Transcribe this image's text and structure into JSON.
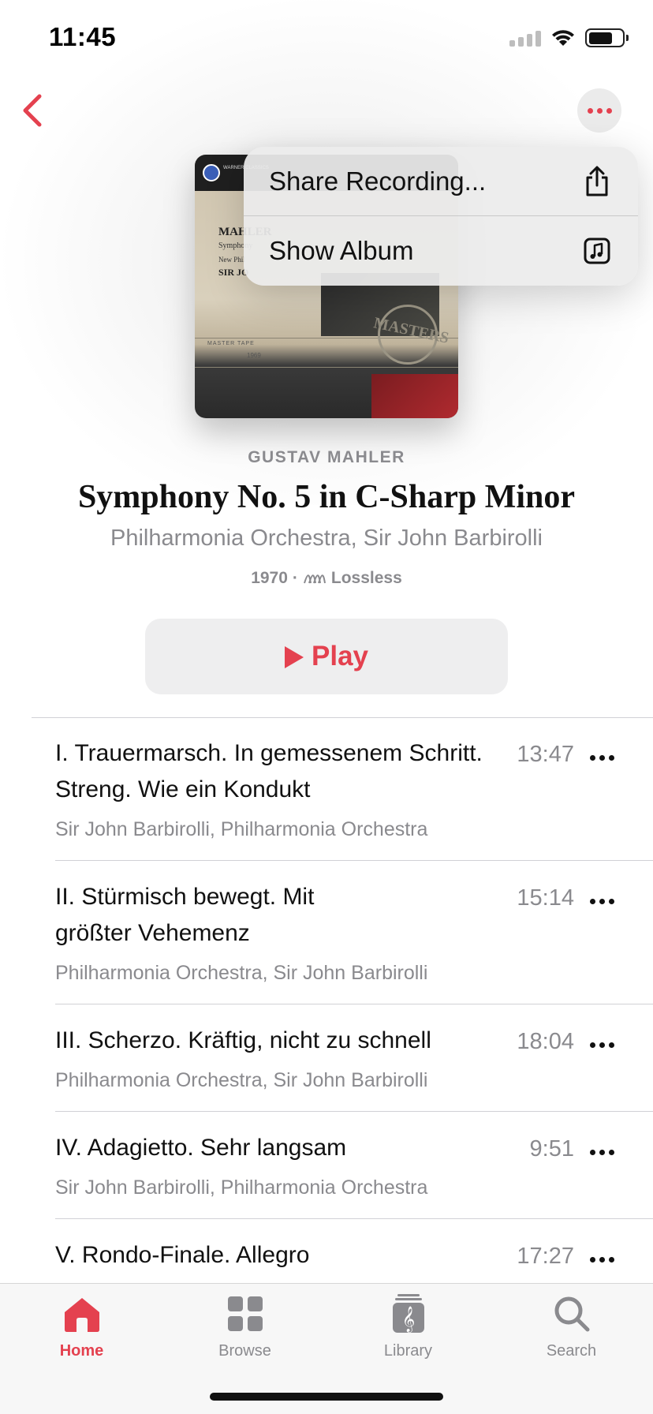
{
  "status_bar": {
    "time": "11:45"
  },
  "colors": {
    "accent": "#e4414f",
    "secondary_text": "#8a8a8e"
  },
  "header": {
    "back_icon": "chevron-left-icon",
    "more_icon": "ellipsis-icon"
  },
  "artwork": {
    "label_text": "WARNER CLASSICS",
    "title_text": "MAHLER",
    "line1": "Symphony",
    "line2": "New Phil",
    "line3": "SIR JO",
    "tape_text": "MASTER    TAPE",
    "year_text": "1969",
    "seal_text": "MASTERS"
  },
  "context_menu": {
    "items": [
      {
        "label": "Share Recording...",
        "icon": "share-icon"
      },
      {
        "label": "Show Album",
        "icon": "album-icon"
      }
    ]
  },
  "album": {
    "composer": "GUSTAV MAHLER",
    "title": "Symphony No. 5 in C-Sharp Minor",
    "artists": "Philharmonia Orchestra, Sir John Barbirolli",
    "year": "1970",
    "separator": "·",
    "quality": "Lossless"
  },
  "play_button": {
    "label": "Play"
  },
  "tracks": [
    {
      "title": "I. Trauermarsch. In gemessenem Schritt. Streng. Wie ein Kondukt",
      "artist": "Sir John Barbirolli, Philharmonia Orchestra",
      "duration": "13:47"
    },
    {
      "title": "II. Stürmisch bewegt. Mit größter Vehemenz",
      "artist": "Philharmonia Orchestra, Sir John Barbirolli",
      "duration": "15:14"
    },
    {
      "title": "III. Scherzo. Kräftig, nicht zu schnell",
      "artist": "Philharmonia Orchestra, Sir John Barbirolli",
      "duration": "18:04"
    },
    {
      "title": "IV. Adagietto. Sehr langsam",
      "artist": "Sir John Barbirolli, Philharmonia Orchestra",
      "duration": "9:51"
    },
    {
      "title": "V. Rondo-Finale. Allegro",
      "artist": "",
      "duration": "17:27"
    }
  ],
  "tab_bar": {
    "tabs": [
      {
        "label": "Home",
        "icon": "home-icon",
        "active": true
      },
      {
        "label": "Browse",
        "icon": "grid-icon",
        "active": false
      },
      {
        "label": "Library",
        "icon": "library-icon",
        "active": false
      },
      {
        "label": "Search",
        "icon": "search-icon",
        "active": false
      }
    ]
  }
}
